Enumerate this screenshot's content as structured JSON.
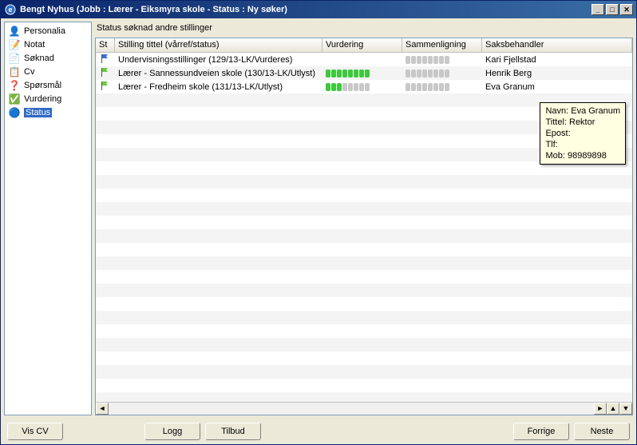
{
  "window": {
    "title": "Bengt Nyhus (Jobb : Lærer - Eiksmyra skole - Status : Ny søker)"
  },
  "sidebar": {
    "items": [
      {
        "icon": "👤",
        "label": "Personalia",
        "selected": false
      },
      {
        "icon": "📝",
        "label": "Notat",
        "selected": false
      },
      {
        "icon": "📄",
        "label": "Søknad",
        "selected": false
      },
      {
        "icon": "📋",
        "label": "Cv",
        "selected": false
      },
      {
        "icon": "❓",
        "label": "Spørsmål",
        "selected": false
      },
      {
        "icon": "✅",
        "label": "Vurdering",
        "selected": false
      },
      {
        "icon": "🔵",
        "label": "Status",
        "selected": true
      }
    ]
  },
  "panel": {
    "title": "Status søknad andre stillinger"
  },
  "table": {
    "columns": {
      "st": "St",
      "title": "Stilling tittel (vårref/status)",
      "vurdering": "Vurdering",
      "sammenligning": "Sammenligning",
      "saksbehandler": "Saksbehandler"
    },
    "rows": [
      {
        "flag_color": "#3a6ed8",
        "title": "Undervisningsstillinger (129/13-LK/Vurderes)",
        "vurdering_on": 0,
        "vurdering_total": 0,
        "samm_on": 0,
        "samm_total": 8,
        "saksbehandler": "Kari Fjellstad"
      },
      {
        "flag_color": "#66cc33",
        "title": "Lærer - Sannessundveien skole (130/13-LK/Utlyst)",
        "vurdering_on": 8,
        "vurdering_total": 8,
        "samm_on": 0,
        "samm_total": 8,
        "saksbehandler": "Henrik Berg"
      },
      {
        "flag_color": "#66cc33",
        "title": "Lærer - Fredheim skole (131/13-LK/Utlyst)",
        "vurdering_on": 3,
        "vurdering_total": 8,
        "samm_on": 0,
        "samm_total": 8,
        "saksbehandler": "Eva Granum"
      }
    ]
  },
  "tooltip": {
    "lines": [
      "Navn: Eva Granum",
      "Tittel: Rektor",
      "Epost:",
      "Tlf:",
      "Mob: 98989898"
    ]
  },
  "footer": {
    "vis_cv": "Vis CV",
    "logg": "Logg",
    "tilbud": "Tilbud",
    "forrige": "Forrige",
    "neste": "Neste"
  }
}
